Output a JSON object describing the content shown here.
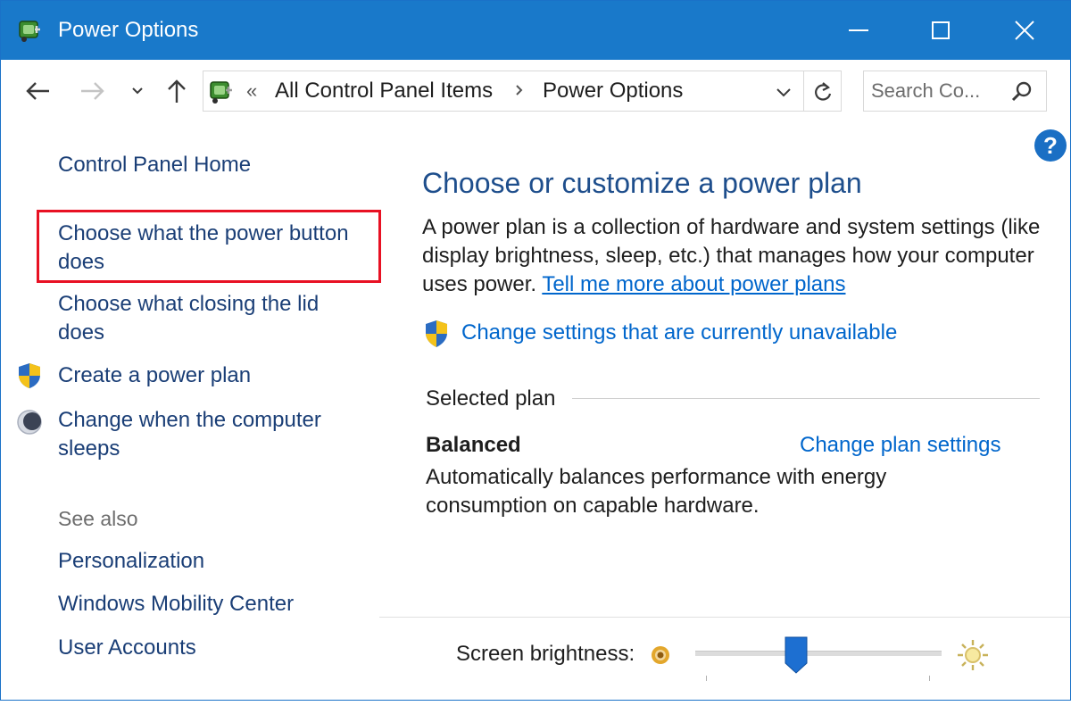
{
  "window": {
    "title": "Power Options",
    "accent": "#1979ca"
  },
  "address": {
    "overflow": "«",
    "crumbs": [
      "All Control Panel Items",
      "Power Options"
    ],
    "search_placeholder": "Search Co..."
  },
  "help": {
    "label": "?"
  },
  "leftnav": {
    "home": "Control Panel Home",
    "links": [
      "Choose what the power button does",
      "Choose what closing the lid does",
      "Create a power plan",
      "Change when the computer sleeps"
    ],
    "see_also_label": "See also",
    "see_also": [
      "Personalization",
      "Windows Mobility Center",
      "User Accounts"
    ],
    "highlight_color": "#e81123"
  },
  "main": {
    "title": "Choose or customize a power plan",
    "description": "A power plan is a collection of hardware and system settings (like display brightness, sleep, etc.) that manages how your computer uses power. ",
    "description_link": "Tell me more about power plans",
    "change_unavailable": "Change settings that are currently unavailable",
    "selected_plan_label": "Selected plan",
    "plan": {
      "name": "Balanced",
      "settings_link": "Change plan settings",
      "description": "Automatically balances performance with energy consumption on capable hardware."
    },
    "brightness": {
      "label": "Screen brightness:",
      "level": 0.41
    }
  }
}
